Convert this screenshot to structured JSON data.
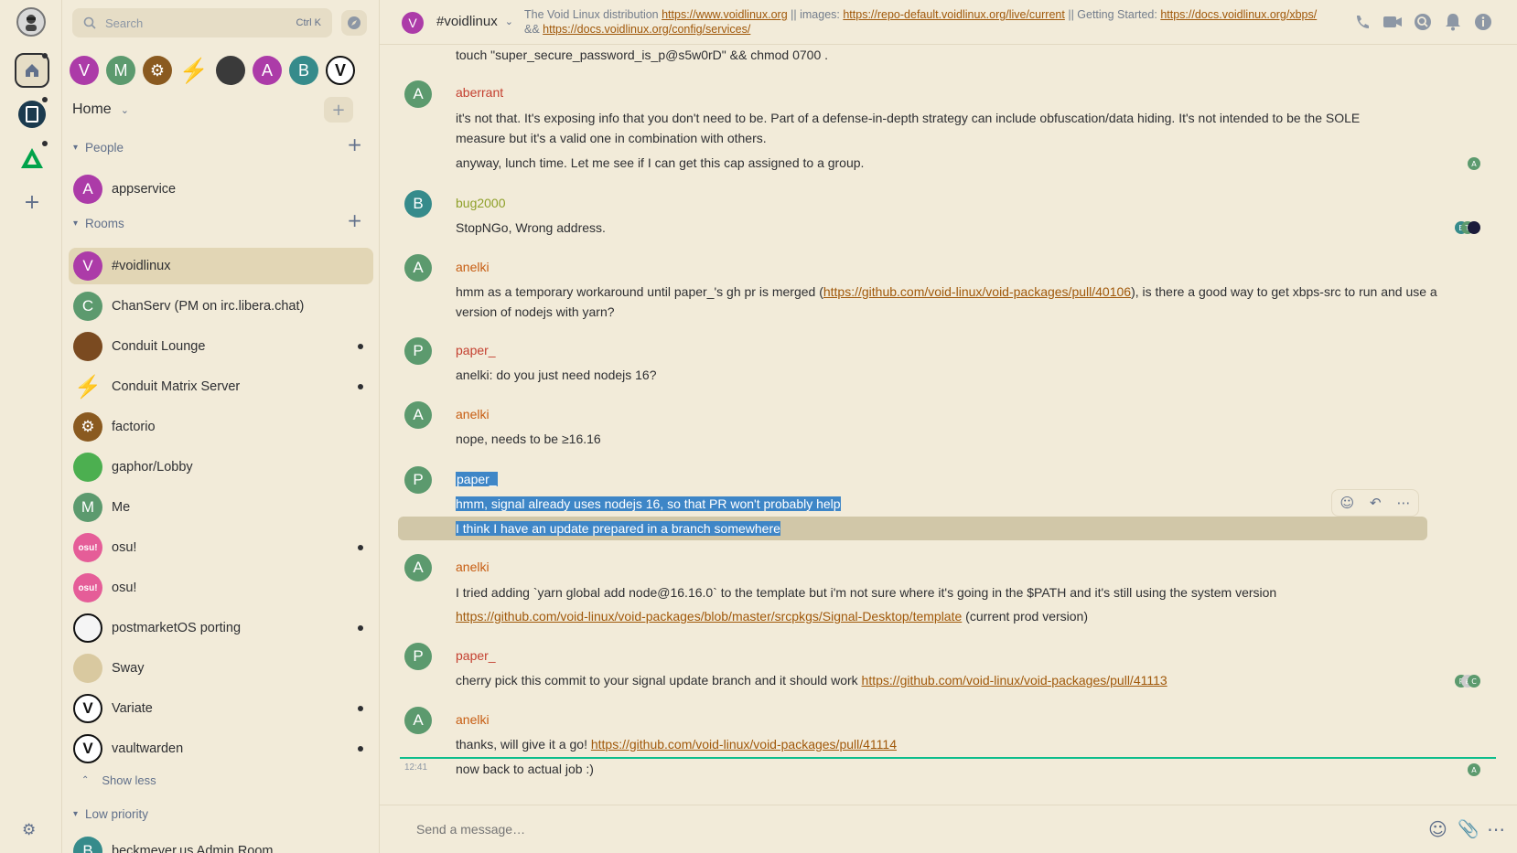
{
  "search": {
    "placeholder": "Search",
    "shortcut": "Ctrl K"
  },
  "home": {
    "title": "Home"
  },
  "sections": {
    "people": "People",
    "rooms": "Rooms",
    "low_priority": "Low priority",
    "show_less": "Show less"
  },
  "people": [
    {
      "name": "appservice",
      "letter": "A",
      "color": "#ac3ba8"
    }
  ],
  "rooms": [
    {
      "name": "#voidlinux",
      "letter": "V",
      "color": "#ac3ba8",
      "unread": false
    },
    {
      "name": "ChanServ (PM on irc.libera.chat)",
      "letter": "C",
      "color": "#5c9a6e",
      "unread": false
    },
    {
      "name": "Conduit Lounge",
      "letter": "",
      "color": "#7a4a20",
      "unread": true
    },
    {
      "name": "Conduit Matrix Server",
      "letter": "⚡",
      "color": "#f0c020",
      "unread": true
    },
    {
      "name": "factorio",
      "letter": "⚙",
      "color": "#8a5a20",
      "unread": false
    },
    {
      "name": "gaphor/Lobby",
      "letter": "",
      "color": "#4caf50",
      "unread": false
    },
    {
      "name": "Me",
      "letter": "M",
      "color": "#5c9a6e",
      "unread": false
    },
    {
      "name": "osu!",
      "letter": "osu!",
      "color": "#e55d98",
      "unread": true
    },
    {
      "name": "osu!",
      "letter": "osu!",
      "color": "#e55d98",
      "unread": false
    },
    {
      "name": "postmarketOS porting",
      "letter": "",
      "color": "#f5f5f5",
      "unread": true
    },
    {
      "name": "Sway",
      "letter": "",
      "color": "#d9c9a0",
      "unread": false
    },
    {
      "name": "Variate",
      "letter": "V",
      "color": "#ffffff",
      "unread": true
    },
    {
      "name": "vaultwarden",
      "letter": "V",
      "color": "#ffffff",
      "unread": true
    }
  ],
  "low_priority_rooms": [
    {
      "name": "beckmeyer.us Admin Room",
      "letter": "B",
      "color": "#368bd6"
    }
  ],
  "header": {
    "room_name": "#voidlinux",
    "topic_prefix": "The Void Linux distribution ",
    "link1": "https://www.voidlinux.org",
    "sep1": " || images: ",
    "link2": "https://repo-default.voidlinux.org/live/current",
    "sep2": " || Getting Started: ",
    "link3": "https://docs.voidlinux.org/xbps/",
    "sep3": " && ",
    "link4": "https://docs.voidlinux.org/config/services/"
  },
  "messages": {
    "m0": "touch \"super_secure_password_is_p@s5w0rD\" && chmod 0700 .",
    "s1": "aberrant",
    "m1a": "it's not that. It's exposing info that you don't need to be. Part of a defense-in-depth strategy can include obfuscation/data hiding. It's not intended to be the SOLE measure but it's a valid one in combination with others.",
    "m1b": "anyway, lunch time. Let me see if I can get this cap assigned to a group.",
    "s2": "bug2000",
    "m2": "StopNGo, Wrong address.",
    "s3": "anelki",
    "m3_pre": "hmm as a temporary workaround until paper_'s gh pr is merged (",
    "m3_link": "https://github.com/void-linux/void-packages/pull/40106",
    "m3_post": "), is there a good way to get xbps-src to run and use a version of nodejs with yarn?",
    "s4": "paper_",
    "m4": "anelki: do you just need nodejs 16?",
    "s5": "anelki",
    "m5": "nope, needs to be ≥16.16",
    "s6": "paper_",
    "m6a": "hmm, signal already uses nodejs 16, so that PR won't probably help",
    "m6b": "I think I have an update prepared in a branch somewhere",
    "s7": "anelki",
    "m7a": "I tried adding `yarn global add node@16.16.0` to the template but i'm not sure where it's going in the $PATH and it's still using the system version",
    "m7_link": "https://github.com/void-linux/void-packages/blob/master/srcpkgs/Signal-Desktop/template",
    "m7_post": " (current prod version)",
    "s8": "paper_",
    "m8_pre": "cherry pick this commit to your signal update branch and it should work ",
    "m8_link": "https://github.com/void-linux/void-packages/pull/41113",
    "s9": "anelki",
    "m9_pre": "thanks, will give it a go! ",
    "m9_link": "https://github.com/void-linux/void-packages/pull/41114",
    "m10_time": "12:41",
    "m10": "now back to actual job :)"
  },
  "composer": {
    "placeholder": "Send a message…"
  },
  "colors": {
    "anelki": "#c75d12",
    "paper": "#c44030",
    "aberrant": "#c44030",
    "bug2000": "#8fa02a",
    "selection": "#3e86c7"
  }
}
